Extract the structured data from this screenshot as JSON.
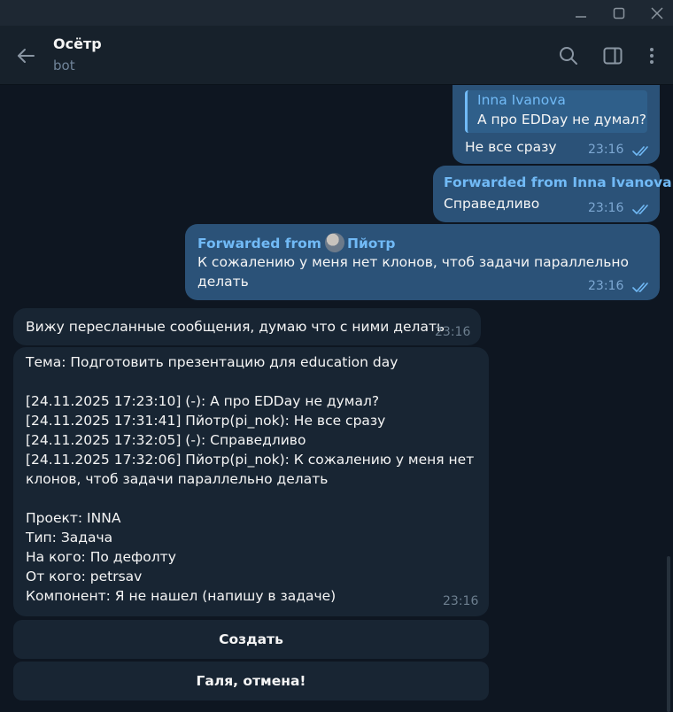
{
  "header": {
    "title": "Осётр",
    "subtitle": "bot"
  },
  "messages": {
    "m1": {
      "reply_name": "Inna Ivanova",
      "reply_text": "А про EDDay не думал?",
      "text": "Не все сразу",
      "time": "23:16"
    },
    "m2": {
      "forwarded": "Forwarded from Inna Ivanova",
      "text": "Справедливо",
      "time": "23:16"
    },
    "m3": {
      "forwarded_prefix": "Forwarded from",
      "forwarded_name": "Пйотр",
      "text": "К сожалению у меня нет клонов, чтоб задачи параллельно\nделать",
      "time": "23:16"
    },
    "m4": {
      "text": "Вижу пересланные сообщения, думаю что с ними делать",
      "time": "23:16"
    },
    "m5": {
      "text": "Тема: Подготовить презентацию для education day\n\n[24.11.2025 17:23:10] (-): А про EDDay не думал?\n[24.11.2025 17:31:41] Пйотр(pi_nok): Не все сразу\n[24.11.2025 17:32:05] (-): Справедливо\n[24.11.2025 17:32:06] Пйотр(pi_nok): К сожалению у меня нет\nклонов, чтоб задачи параллельно делать\n\nПроект: INNA\nТип: Задача\nНа кого: По дефолту\nОт кого: petrsav\nКомпонент: Я не нашел (напишу в задаче)",
      "time": "23:16"
    }
  },
  "keyboard": {
    "create": "Создать",
    "cancel": "Галя, отмена!"
  },
  "colors": {
    "background": "#0e1621",
    "outgoing": "#2b5278",
    "incoming": "#182533",
    "accent": "#71baf6"
  }
}
